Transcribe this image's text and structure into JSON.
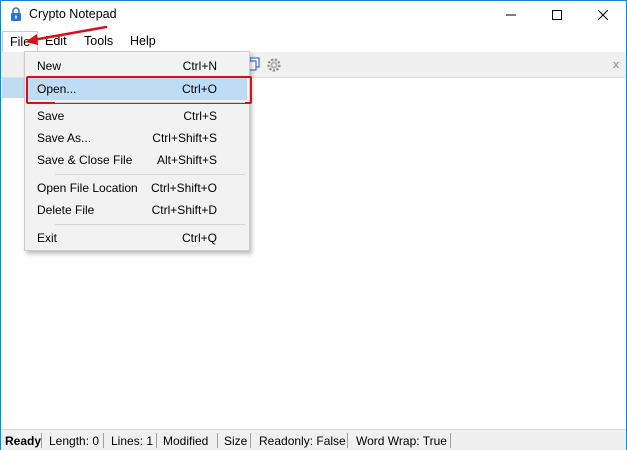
{
  "window": {
    "title": "Crypto Notepad"
  },
  "menubar": {
    "file": "File",
    "edit": "Edit",
    "tools": "Tools",
    "help": "Help"
  },
  "file_menu": {
    "items": [
      {
        "label": "New",
        "shortcut": "Ctrl+N"
      },
      {
        "label": "Open...",
        "shortcut": "Ctrl+O"
      },
      {
        "label": "Save",
        "shortcut": "Ctrl+S"
      },
      {
        "label": "Save As...",
        "shortcut": "Ctrl+Shift+S"
      },
      {
        "label": "Save & Close File",
        "shortcut": "Alt+Shift+S"
      },
      {
        "label": "Open File Location",
        "shortcut": "Ctrl+Shift+O"
      },
      {
        "label": "Delete File",
        "shortcut": "Ctrl+Shift+D"
      },
      {
        "label": "Exit",
        "shortcut": "Ctrl+Q"
      }
    ]
  },
  "toolbar": {
    "close_glyph": "x"
  },
  "statusbar": {
    "ready": "Ready",
    "length": "Length: 0",
    "lines": "Lines: 1",
    "modified": "Modified",
    "size": "Size",
    "readonly": "Readonly: False",
    "wordwrap": "Word Wrap: True"
  },
  "colors": {
    "highlight": "#bfdcf5",
    "annotation_red": "#d9101c",
    "window_border": "#1883d7"
  }
}
